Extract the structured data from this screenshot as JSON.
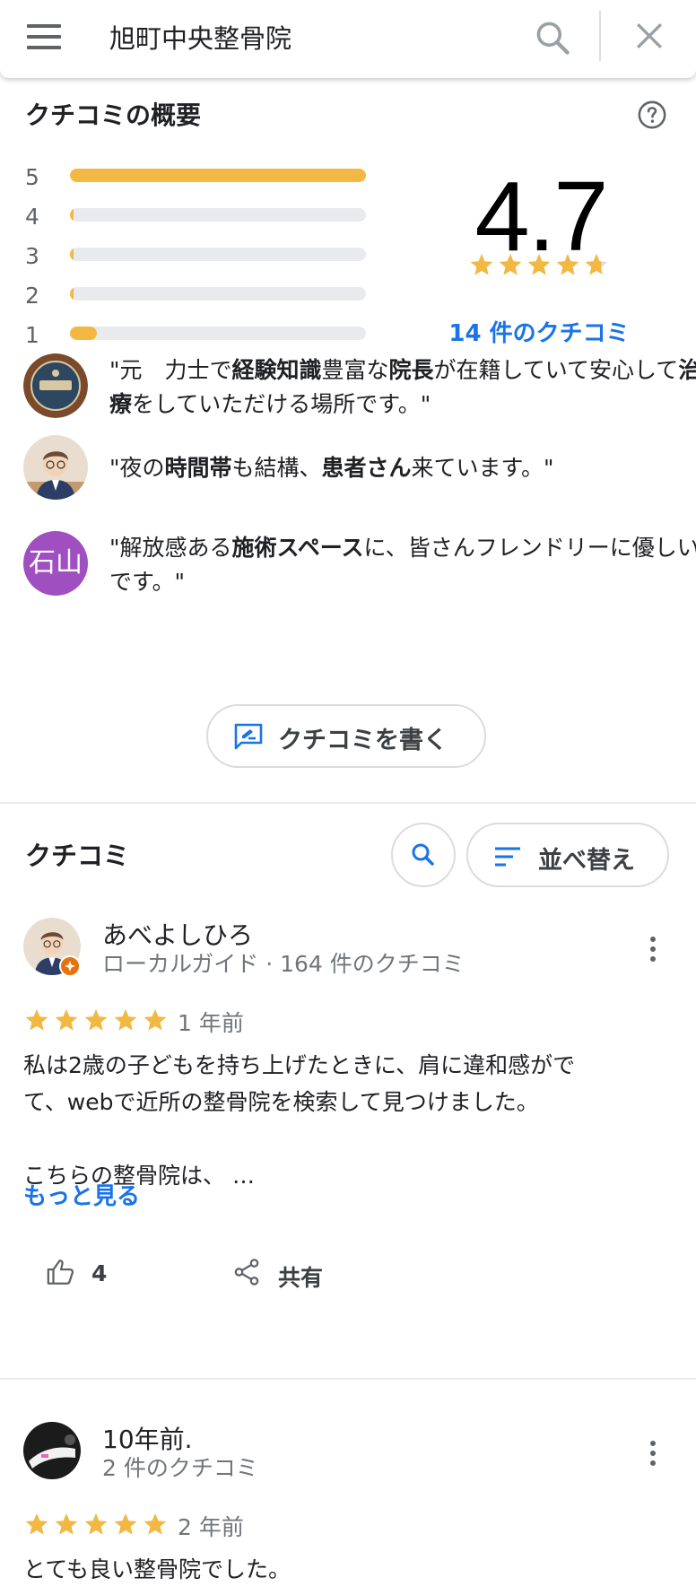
{
  "search": {
    "query": "旭町中央整骨院"
  },
  "summary": {
    "title": "クチコミの概要",
    "rating": "4.7",
    "rating_value": 4.7,
    "review_count_label": "14 件のクチコミ",
    "distribution": [
      {
        "label": "5",
        "fraction": 1.0
      },
      {
        "label": "4",
        "fraction": 0.012
      },
      {
        "label": "3",
        "fraction": 0.012
      },
      {
        "label": "2",
        "fraction": 0.012
      },
      {
        "label": "1",
        "fraction": 0.09
      }
    ],
    "star_color": "#f2b842"
  },
  "highlights": [
    {
      "icon": "sumo-badge-avatar",
      "segments": [
        {
          "t": "\"元　力士で",
          "b": false
        },
        {
          "t": "経験知識",
          "b": true
        },
        {
          "t": "豊富な",
          "b": false
        },
        {
          "t": "院長",
          "b": true
        },
        {
          "t": "が在籍していて安心して",
          "b": false
        },
        {
          "t": "治療",
          "b": true
        },
        {
          "t": "をしていただける場所です。\"",
          "b": false
        }
      ]
    },
    {
      "icon": "cartoon-man-avatar",
      "segments": [
        {
          "t": "\"夜の",
          "b": false
        },
        {
          "t": "時間帯",
          "b": true
        },
        {
          "t": "も結構、",
          "b": false
        },
        {
          "t": "患者さん",
          "b": true
        },
        {
          "t": "来ています。\"",
          "b": false
        }
      ]
    },
    {
      "initials": "石山",
      "segments": [
        {
          "t": "\"解放感ある",
          "b": false
        },
        {
          "t": "施術スペース",
          "b": true
        },
        {
          "t": "に、皆さんフレンドリーに優しいです。\"",
          "b": false
        }
      ]
    }
  ],
  "write_review_label": "クチコミを書く",
  "reviews_section": {
    "title": "クチコミ",
    "sort_label": "並べ替え"
  },
  "reviews": [
    {
      "name": "あべよしひろ",
      "meta": "ローカルガイド · 164 件のクチコミ",
      "stars": 5,
      "age": "1 年前",
      "text_lines": [
        "私は2歳の子どもを持ち上げたときに、肩に違和感がで",
        "て、webで近所の整骨院を検索して見つけました。",
        "",
        "こちらの整骨院は、 …"
      ],
      "more_label": "もっと見る",
      "likes": "4",
      "share_label": "共有"
    },
    {
      "name": "10年前.",
      "meta": "2 件のクチコミ",
      "stars": 5,
      "age": "2 年前",
      "text_lines": [
        "とても良い整骨院でした。"
      ]
    }
  ],
  "colors": {
    "accent": "#1a73e8",
    "star": "#f2b842",
    "muted": "#70757a"
  }
}
